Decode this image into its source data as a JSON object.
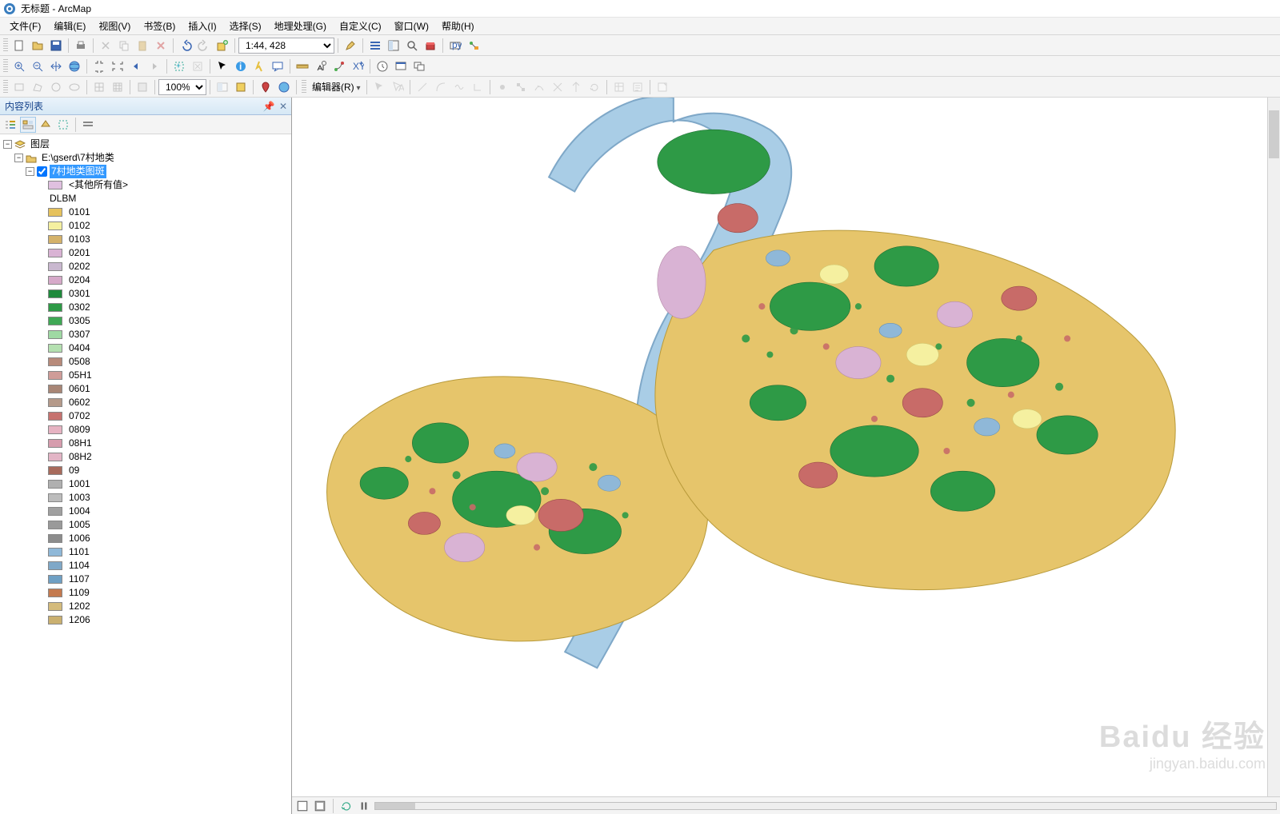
{
  "window": {
    "title": "无标题 - ArcMap"
  },
  "menus": [
    {
      "label": "文件(F)"
    },
    {
      "label": "编辑(E)"
    },
    {
      "label": "视图(V)"
    },
    {
      "label": "书签(B)"
    },
    {
      "label": "插入(I)"
    },
    {
      "label": "选择(S)"
    },
    {
      "label": "地理处理(G)"
    },
    {
      "label": "自定义(C)"
    },
    {
      "label": "窗口(W)"
    },
    {
      "label": "帮助(H)"
    }
  ],
  "scale": "1:44, 428",
  "zoom_percent": "100%",
  "editor": {
    "label": "编辑器(R)"
  },
  "toc": {
    "title": "内容列表",
    "root": "图层",
    "group_path": "E:\\gserd\\7村地类",
    "layer": "7村地类图斑",
    "other_values": "<其他所有值>",
    "field": "DLBM",
    "classes": [
      {
        "code": "0101",
        "color": "#e6c25d"
      },
      {
        "code": "0102",
        "color": "#f5f0a0"
      },
      {
        "code": "0103",
        "color": "#d4b26a"
      },
      {
        "code": "0201",
        "color": "#d9b3d4"
      },
      {
        "code": "0202",
        "color": "#c9b8cf"
      },
      {
        "code": "0204",
        "color": "#d6a9c9"
      },
      {
        "code": "0301",
        "color": "#1f8a3c"
      },
      {
        "code": "0302",
        "color": "#2e9a46"
      },
      {
        "code": "0305",
        "color": "#3fa855"
      },
      {
        "code": "0307",
        "color": "#9fd9a3"
      },
      {
        "code": "0404",
        "color": "#b4e0b0"
      },
      {
        "code": "0508",
        "color": "#b78a7a"
      },
      {
        "code": "05H1",
        "color": "#cf9c98"
      },
      {
        "code": "0601",
        "color": "#a88676"
      },
      {
        "code": "0602",
        "color": "#b59a8a"
      },
      {
        "code": "0702",
        "color": "#c6726f"
      },
      {
        "code": "0809",
        "color": "#e6b3c2"
      },
      {
        "code": "08H1",
        "color": "#d69cad"
      },
      {
        "code": "08H2",
        "color": "#e3b5c6"
      },
      {
        "code": "09",
        "color": "#a86b5c"
      },
      {
        "code": "1001",
        "color": "#b0b0b0"
      },
      {
        "code": "1003",
        "color": "#bcbcbc"
      },
      {
        "code": "1004",
        "color": "#a0a0a0"
      },
      {
        "code": "1005",
        "color": "#9a9a9a"
      },
      {
        "code": "1006",
        "color": "#8c8c8c"
      },
      {
        "code": "1101",
        "color": "#8fb8d8"
      },
      {
        "code": "1104",
        "color": "#7fa8c8"
      },
      {
        "code": "1107",
        "color": "#6fa0c4"
      },
      {
        "code": "1109",
        "color": "#c47a4f"
      },
      {
        "code": "1202",
        "color": "#d4bb7c"
      },
      {
        "code": "1206",
        "color": "#cab070"
      }
    ]
  },
  "watermark": {
    "brand": "Baidu 经验",
    "url": "jingyan.baidu.com"
  }
}
